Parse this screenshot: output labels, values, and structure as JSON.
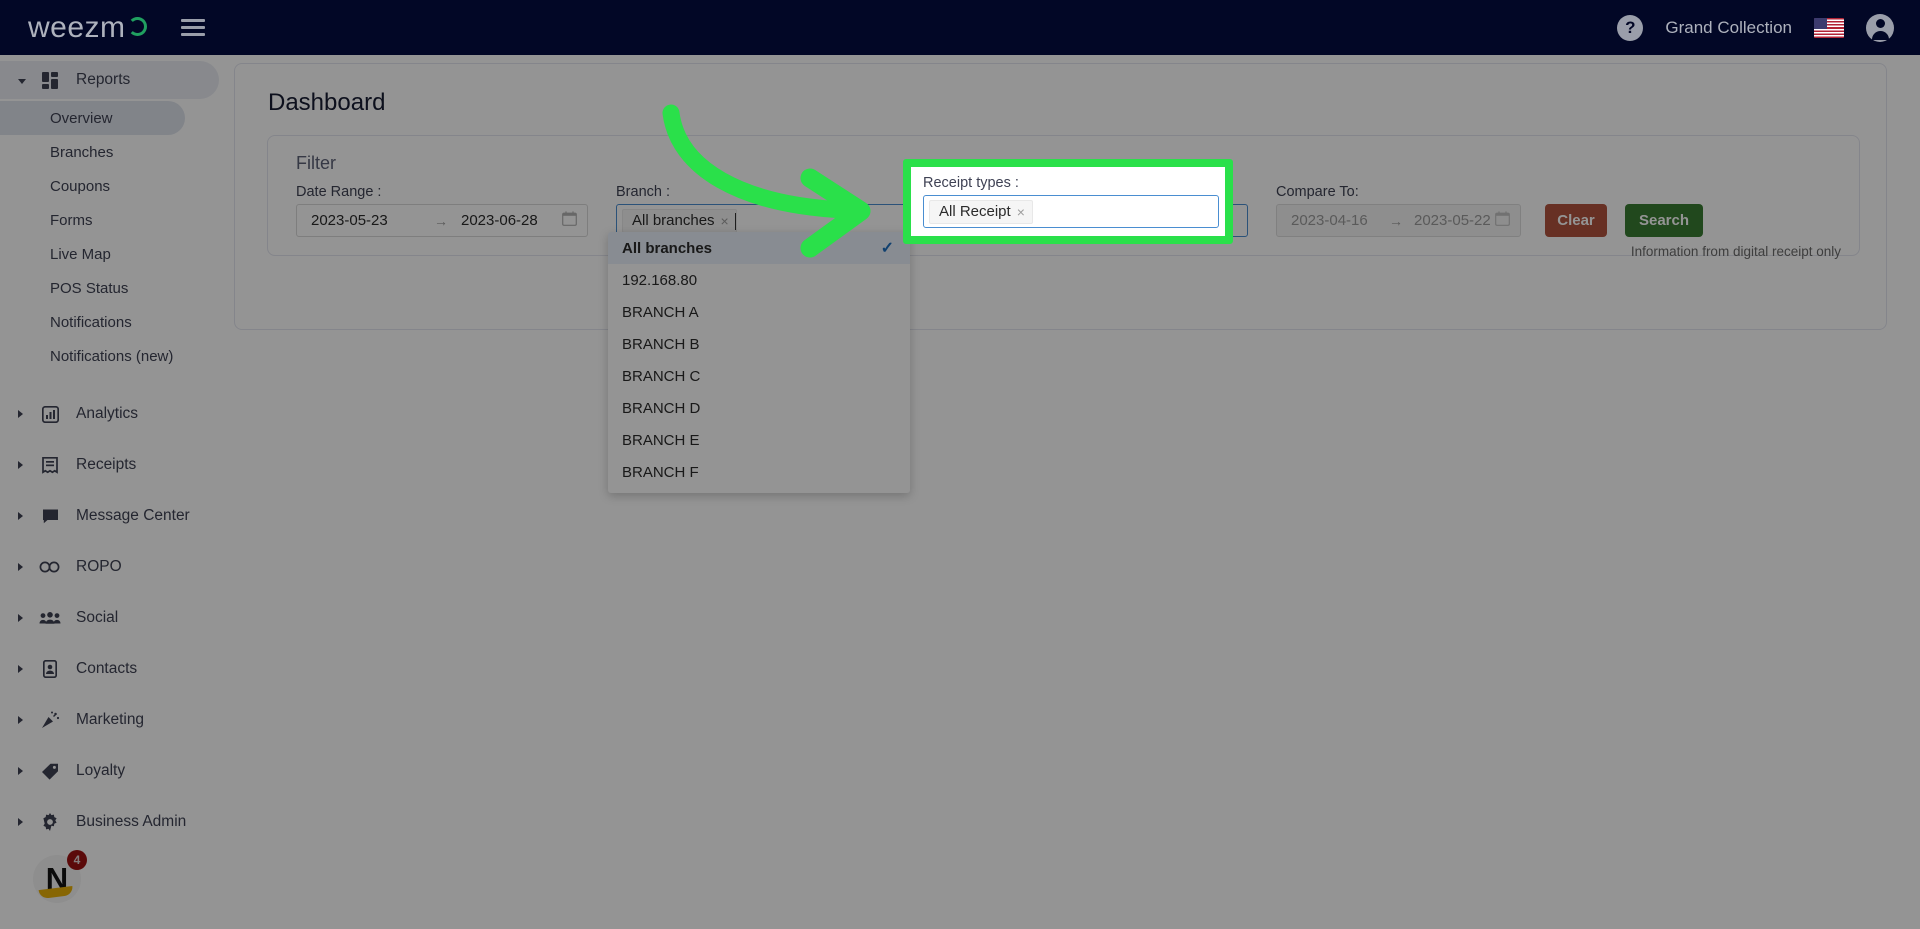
{
  "topbar": {
    "logo_text": "weezm",
    "logo_icon": "weezmo-logo-o",
    "menu_icon": "hamburger-menu-icon",
    "help_icon": "?",
    "account_name": "Grand Collection",
    "flag_icon": "us-flag-icon",
    "avatar_icon": "user-avatar-icon"
  },
  "sidebar": {
    "groups": [
      {
        "label": "Reports",
        "icon": "dashboard-grid-icon",
        "expanded": true,
        "children": [
          "Overview",
          "Branches",
          "Coupons",
          "Forms",
          "Live Map",
          "POS Status",
          "Notifications",
          "Notifications (new)"
        ],
        "selected_child": "Overview"
      },
      {
        "label": "Analytics",
        "icon": "bar-chart-icon",
        "expanded": false
      },
      {
        "label": "Receipts",
        "icon": "receipt-icon",
        "expanded": false
      },
      {
        "label": "Message Center",
        "icon": "speech-bubble-icon",
        "expanded": false
      },
      {
        "label": "ROPO",
        "icon": "infinity-icon",
        "expanded": false
      },
      {
        "label": "Social",
        "icon": "people-group-icon",
        "expanded": false
      },
      {
        "label": "Contacts",
        "icon": "contact-card-icon",
        "expanded": false
      },
      {
        "label": "Marketing",
        "icon": "party-popper-icon",
        "expanded": false
      },
      {
        "label": "Loyalty",
        "icon": "price-tag-icon",
        "expanded": false
      },
      {
        "label": "Business Admin",
        "icon": "gear-icon",
        "expanded": false
      }
    ],
    "brand_badge": {
      "initial": "N",
      "count": "4"
    }
  },
  "main": {
    "page_title": "Dashboard",
    "filter": {
      "title": "Filter",
      "date_range": {
        "label": "Date Range :",
        "start": "2023-05-23",
        "arrow": "→",
        "end": "2023-06-28",
        "calendar_icon": "calendar-icon"
      },
      "branch": {
        "label": "Branch :",
        "tag": "All branches",
        "tag_remove": "×"
      },
      "receipt_types": {
        "label": "Receipt types :",
        "tag": "All Receipt",
        "tag_remove": "×"
      },
      "compare_to": {
        "label": "Compare To:",
        "start": "2023-04-16",
        "arrow": "→",
        "end": "2023-05-22",
        "calendar_icon": "calendar-icon",
        "disabled": true
      },
      "clear_button": "Clear",
      "search_button": "Search",
      "note": "Information from digital receipt only"
    },
    "branch_dropdown": {
      "options": [
        "All branches",
        "192.168.80",
        "BRANCH A",
        "BRANCH B",
        "BRANCH C",
        "BRANCH D",
        "BRANCH E",
        "BRANCH F"
      ],
      "selected": "All branches",
      "check_glyph": "✓"
    }
  },
  "colors": {
    "topbar_bg": "#020726",
    "accent_green": "#2ae04a",
    "search_button": "#3a7d32",
    "clear_button": "#b1543e",
    "highlight_border": "#2ae04a",
    "selected_nav": "#dfe3ec",
    "badge_red": "#9e1212"
  },
  "annotation": {
    "arrow_icon": "green-curved-arrow",
    "arrow_color": "#2ae04a"
  }
}
